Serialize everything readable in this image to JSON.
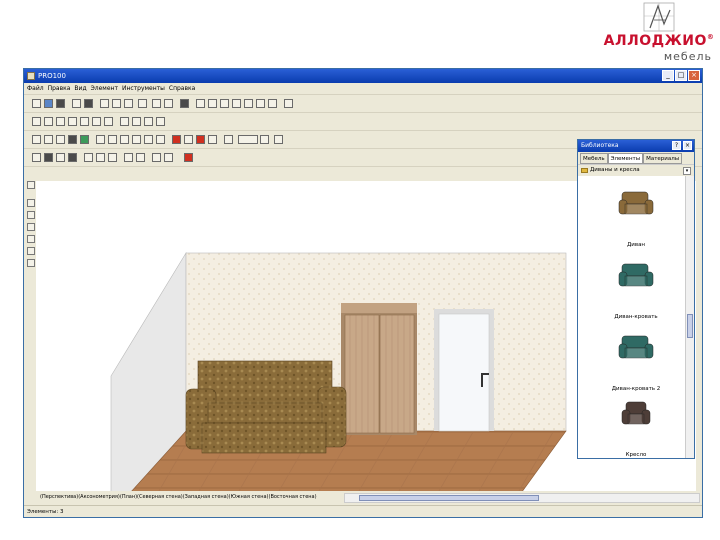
{
  "brand": {
    "name": "АЛЛОДЖИО",
    "mark": "®",
    "subtitle": "мебель"
  },
  "window": {
    "title": "PRO100",
    "buttons": [
      "_",
      "□",
      "×"
    ]
  },
  "menu": [
    "Файл",
    "Правка",
    "Вид",
    "Элемент",
    "Инструменты",
    "Справка"
  ],
  "library": {
    "title": "Библиотека",
    "tabs": [
      "Мебель",
      "Элементы",
      "Материалы"
    ],
    "active_tab": 1,
    "path": "Диваны и кресла",
    "items": [
      {
        "label": "Диван",
        "color": "#8a6a3a"
      },
      {
        "label": "Диван-кровать",
        "color": "#2f6a64"
      },
      {
        "label": "Диван-кровать 2",
        "color": "#2f6a64"
      },
      {
        "label": "Кресло",
        "color": "#4e3e38"
      }
    ]
  },
  "views": "(Перспектива)(Аксонометрия)(План)(Северная стена)(Западная стена)(Южная стена)(Восточная стена)",
  "status": "Элементы: 3",
  "colors": {
    "wall": "#f4eee2",
    "side_wall": "#e8e8e8",
    "floor": "#b57d50",
    "sofa": "#8a6c3a",
    "wardrobe": "#c8a888",
    "door": "#f6f8fa",
    "logo_red": "#c8102e"
  }
}
